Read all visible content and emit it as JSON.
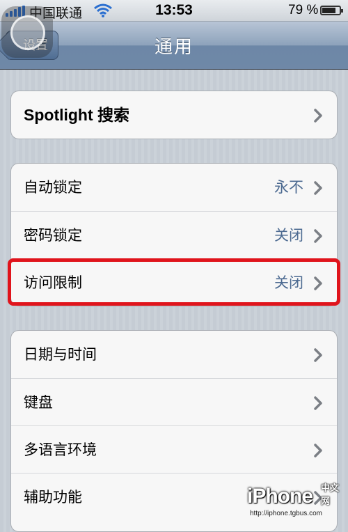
{
  "status_bar": {
    "carrier": "中国联通",
    "time": "13:53",
    "battery_percent": "79 %",
    "battery_level": 0.79,
    "signal_icon": "signal-bars-icon",
    "wifi_icon": "wifi-icon"
  },
  "nav": {
    "back_label": "设置",
    "title": "通用"
  },
  "groups": [
    {
      "rows": [
        {
          "label": "Spotlight 搜索",
          "value": ""
        }
      ]
    },
    {
      "rows": [
        {
          "label": "自动锁定",
          "value": "永不"
        },
        {
          "label": "密码锁定",
          "value": "关闭"
        },
        {
          "label": "访问限制",
          "value": "关闭"
        }
      ]
    },
    {
      "rows": [
        {
          "label": "日期与时间",
          "value": ""
        },
        {
          "label": "键盘",
          "value": ""
        },
        {
          "label": "多语言环境",
          "value": ""
        },
        {
          "label": "辅助功能",
          "value": ""
        }
      ]
    }
  ],
  "colors": {
    "highlight": "#e0141c",
    "value_text": "#4c6a91",
    "nav_bar": "#6d87a7"
  },
  "watermark": {
    "logo": "iPhone",
    "cn": "中文网",
    "url": "http://iphone.tgbus.com"
  }
}
